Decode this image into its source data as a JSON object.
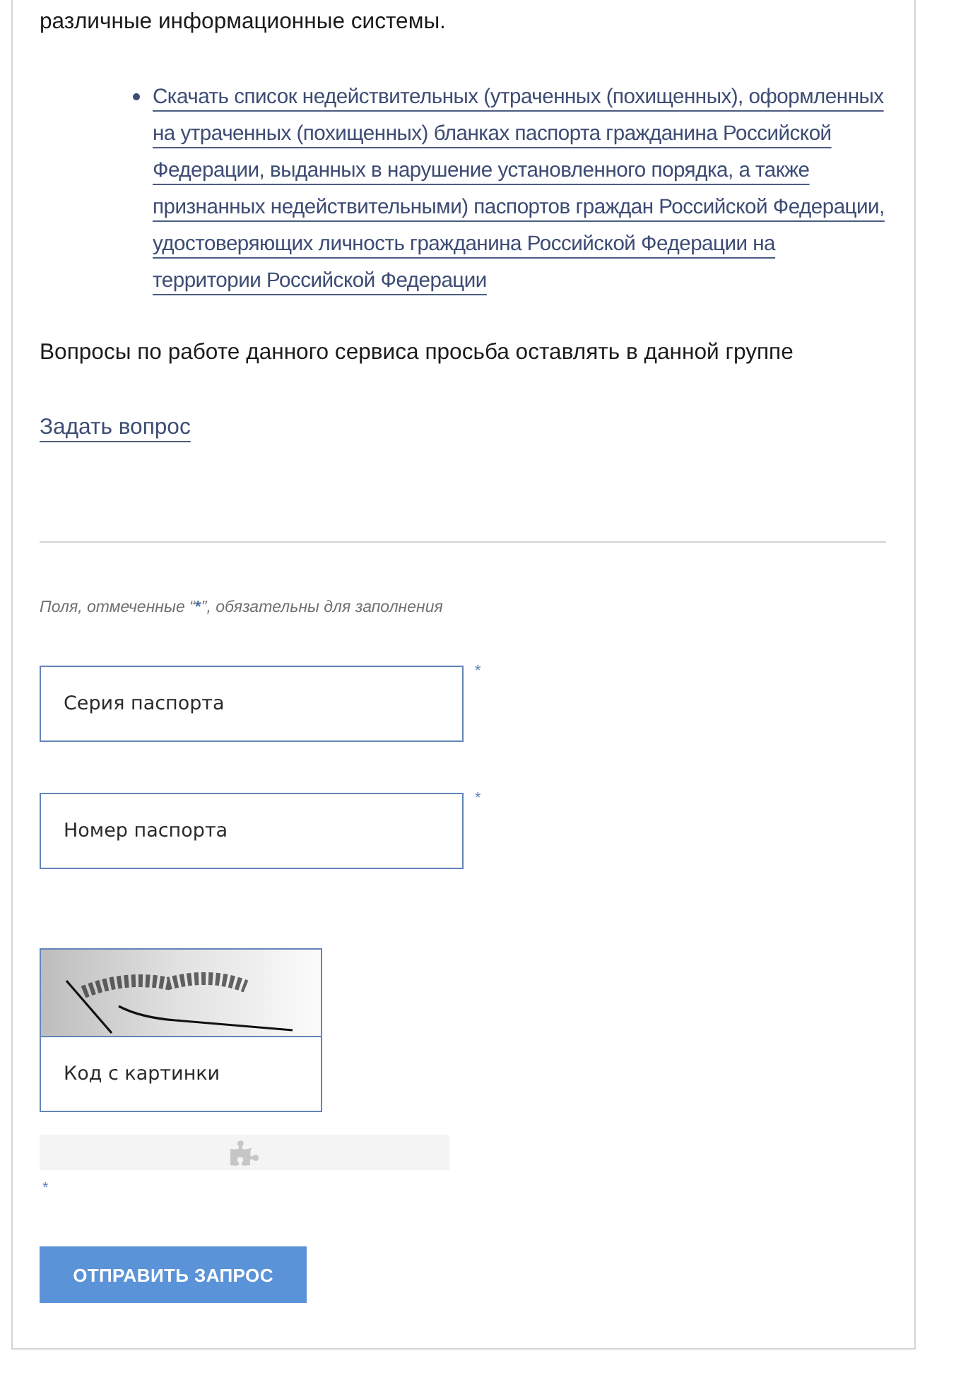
{
  "intro_text": "различные информационные системы.",
  "links": [
    {
      "text": "Скачать список недействительных (утраченных (похищенных), оформленных на утраченных (похищенных) бланках паспорта гражданина Российской Федерации, выданных в нарушение установленного порядка, а также признанных недействительными) паспортов граждан Российской Федерации, удостоверяющих личность гражданина Российской Федерации на территории Российской Федерации"
    }
  ],
  "questions_text": "Вопросы по работе данного сервиса просьба оставлять в данной группе",
  "ask_link": "Задать вопрос",
  "form": {
    "note": {
      "before": "Поля, отмеченные “",
      "mark": "*",
      "after": "”, обязательны для заполнения"
    },
    "fields": [
      {
        "placeholder": "Серия паспорта",
        "required_mark": "*"
      },
      {
        "placeholder": "Номер паспорта",
        "required_mark": "*"
      }
    ],
    "captcha": {
      "placeholder": "Код с картинки"
    },
    "widget_required_mark": "*",
    "submit": "ОТПРАВИТЬ ЗАПРОС"
  }
}
